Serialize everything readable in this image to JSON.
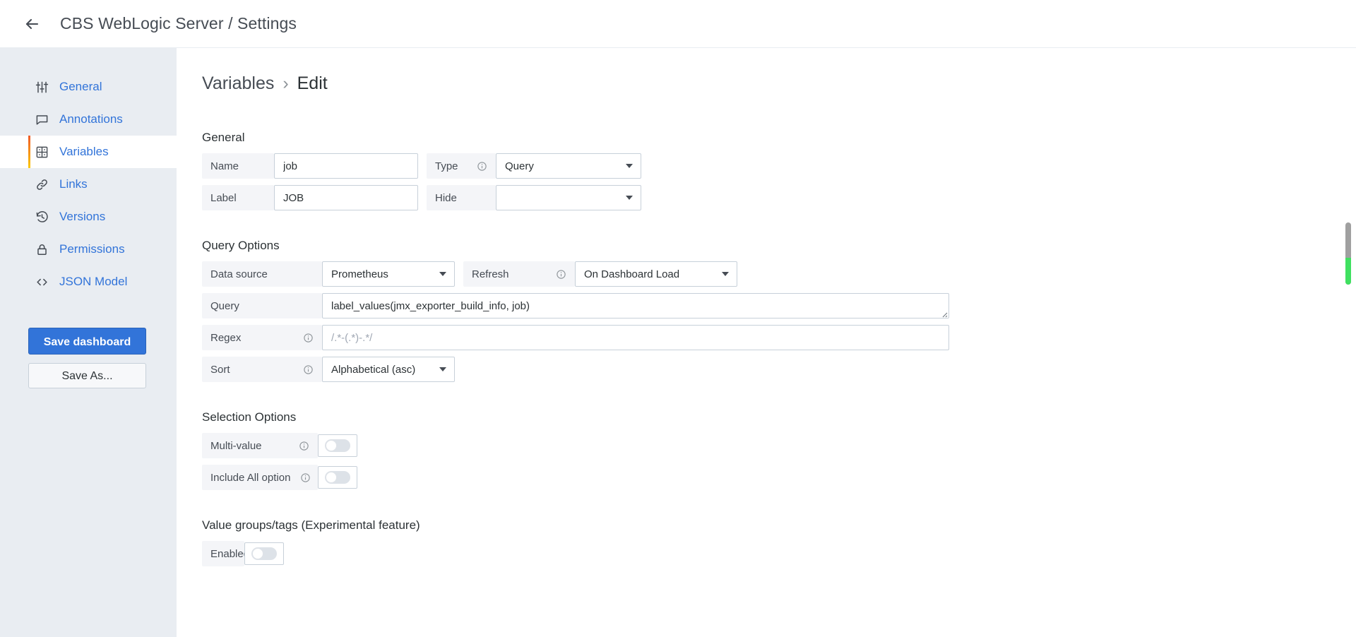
{
  "topbar": {
    "back_icon": "arrow-left-icon",
    "title": "CBS WebLogic Server / Settings"
  },
  "sidebar": {
    "items": [
      {
        "label": "General",
        "icon": "sliders-icon",
        "active": false
      },
      {
        "label": "Annotations",
        "icon": "comment-icon",
        "active": false
      },
      {
        "label": "Variables",
        "icon": "table-icon",
        "active": true
      },
      {
        "label": "Links",
        "icon": "link-icon",
        "active": false
      },
      {
        "label": "Versions",
        "icon": "history-icon",
        "active": false
      },
      {
        "label": "Permissions",
        "icon": "lock-icon",
        "active": false
      },
      {
        "label": "JSON Model",
        "icon": "code-icon",
        "active": false
      }
    ],
    "save_dashboard_label": "Save dashboard",
    "save_as_label": "Save As...",
    "accent_from": "#f05a28",
    "accent_to": "#fbca0a",
    "primary_color": "#3274d9",
    "background": "#e9edf2"
  },
  "page": {
    "breadcrumb_root": "Variables",
    "breadcrumb_sep": "›",
    "breadcrumb_current": "Edit"
  },
  "general": {
    "section_title": "General",
    "name_label": "Name",
    "name_value": "job",
    "type_label": "Type",
    "type_value": "Query",
    "label_label": "Label",
    "label_value": "JOB",
    "hide_label": "Hide",
    "hide_value": ""
  },
  "query_options": {
    "section_title": "Query Options",
    "datasource_label": "Data source",
    "datasource_value": "Prometheus",
    "refresh_label": "Refresh",
    "refresh_value": "On Dashboard Load",
    "query_label": "Query",
    "query_value": "label_values(jmx_exporter_build_info, job)",
    "regex_label": "Regex",
    "regex_value": "",
    "regex_placeholder": "/.*-(.*)-.*/",
    "sort_label": "Sort",
    "sort_value": "Alphabetical (asc)"
  },
  "selection_options": {
    "section_title": "Selection Options",
    "multi_value_label": "Multi-value",
    "multi_value_on": false,
    "include_all_label": "Include All option",
    "include_all_on": false
  },
  "value_groups": {
    "section_title": "Value groups/tags (Experimental feature)",
    "enabled_label": "Enabled",
    "enabled_on": false
  },
  "scrollbar": {
    "thumb_color": "#a0a0a0",
    "indicator_color": "#40e060"
  }
}
